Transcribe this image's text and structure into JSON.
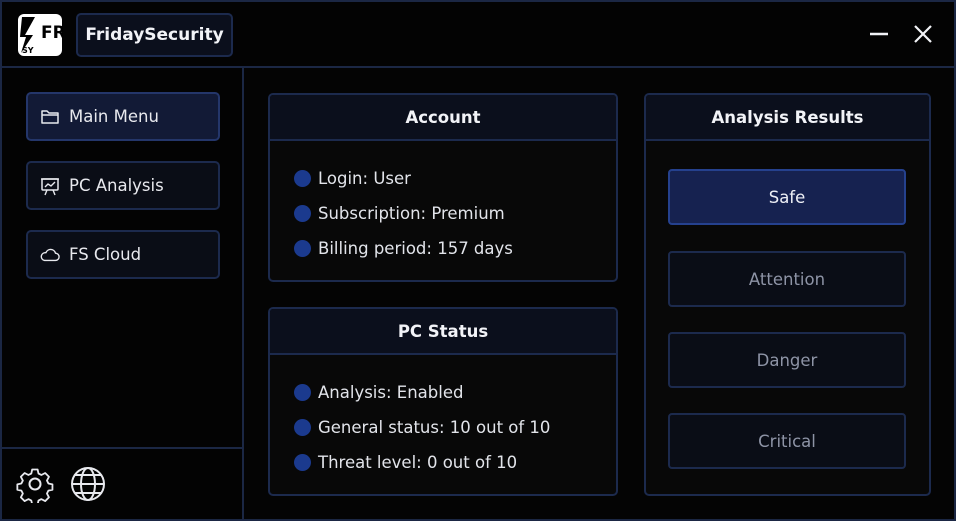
{
  "app": {
    "title": "FridaySecurity",
    "logo_text_big": "FR",
    "logo_text_small": "SY"
  },
  "sidebar": {
    "items": [
      {
        "label": "Main Menu",
        "icon": "folder-icon",
        "active": true
      },
      {
        "label": "PC Analysis",
        "icon": "presentation-chart-icon",
        "active": false
      },
      {
        "label": "FS Cloud",
        "icon": "cloud-icon",
        "active": false
      }
    ],
    "footer_icons": [
      "gear-icon",
      "globe-icon"
    ]
  },
  "account": {
    "title": "Account",
    "rows": [
      "Login: User",
      "Subscription: Premium",
      "Billing period: 157 days"
    ]
  },
  "pc_status": {
    "title": "PC Status",
    "rows": [
      "Analysis: Enabled",
      "General status: 10 out of 10",
      "Threat level: 0 out of 10"
    ]
  },
  "analysis_results": {
    "title": "Analysis Results",
    "buttons": [
      {
        "label": "Safe",
        "active": true
      },
      {
        "label": "Attention",
        "active": false
      },
      {
        "label": "Danger",
        "active": false
      },
      {
        "label": "Critical",
        "active": false
      }
    ]
  },
  "colors": {
    "accent": "#1b3a8e",
    "border": "#1c2a4d",
    "active_button": "#162250",
    "background": "#040404"
  }
}
